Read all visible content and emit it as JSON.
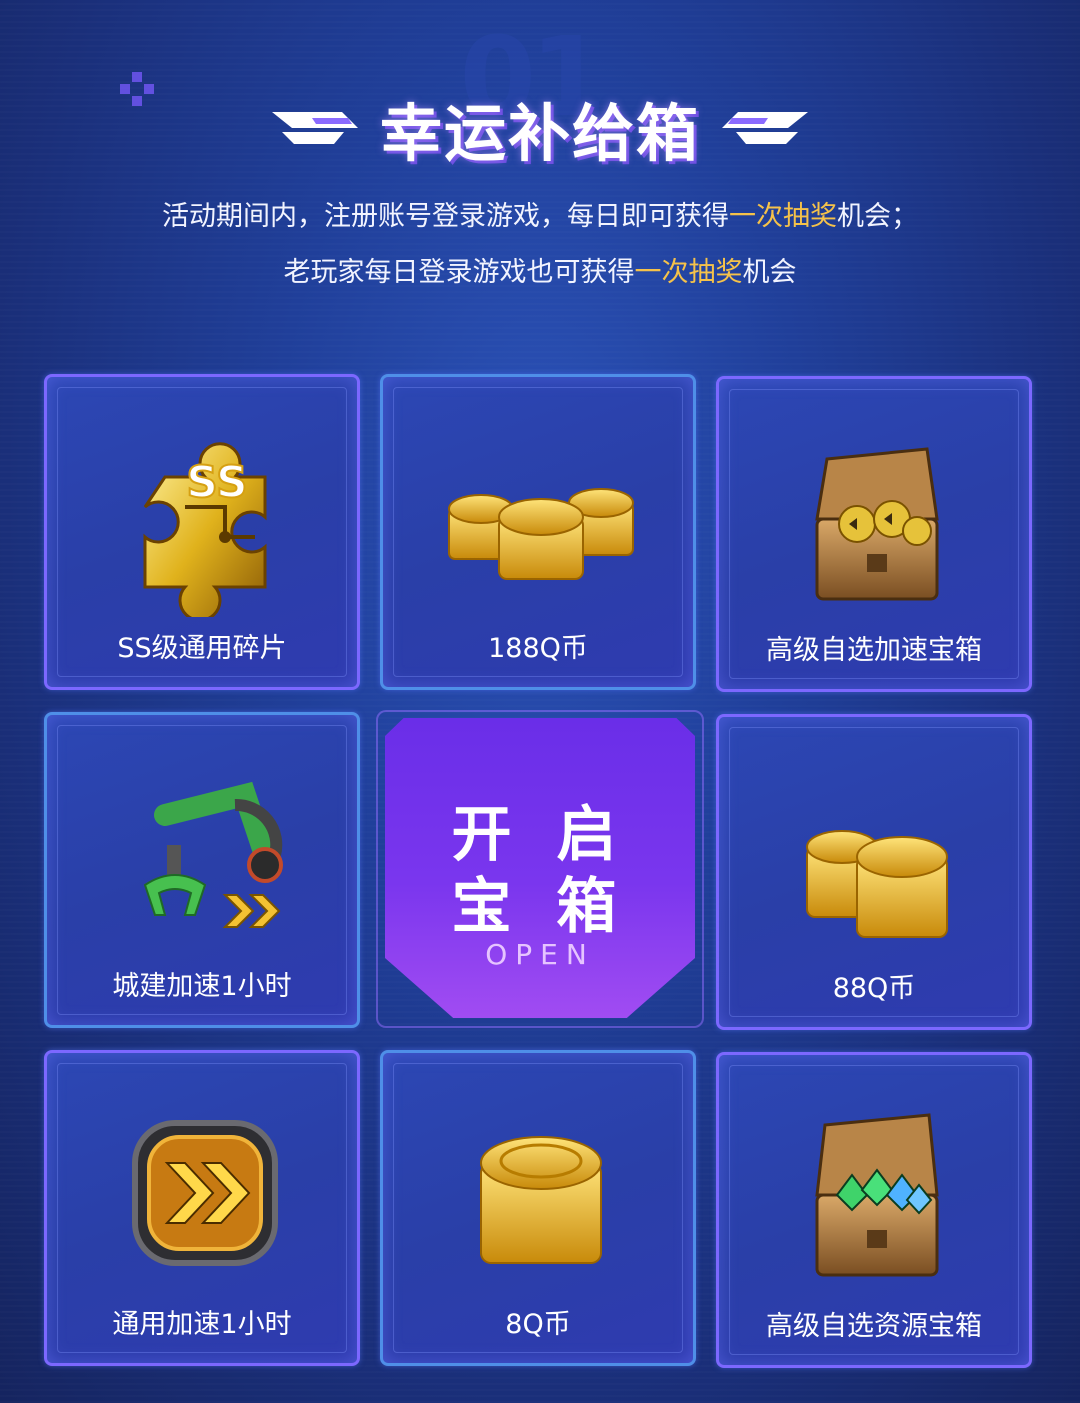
{
  "header": {
    "watermark": "01",
    "title": "幸运补给箱",
    "desc_line1": {
      "before": "活动期间内，注册账号登录游戏，每日即可获得",
      "highlight": "一次抽奖",
      "after": "机会；"
    },
    "desc_line2": {
      "before": "老玩家每日登录游戏也可获得",
      "highlight": "一次抽奖",
      "after": "机会"
    }
  },
  "rewards": [
    {
      "label": "SS级通用碎片",
      "icon": "puzzle-piece-icon"
    },
    {
      "label": "188Q币",
      "icon": "coin-pile-icon"
    },
    {
      "label": "高级自选加速宝箱",
      "icon": "speedup-chest-icon"
    },
    {
      "label": "城建加速1小时",
      "icon": "crane-claw-icon"
    },
    {
      "label": "88Q币",
      "icon": "coin-stack-icon"
    },
    {
      "label": "通用加速1小时",
      "icon": "speedup-badge-icon"
    },
    {
      "label": "8Q币",
      "icon": "coin-icon"
    },
    {
      "label": "高级自选资源宝箱",
      "icon": "resource-chest-icon"
    }
  ],
  "open_button": {
    "line1": "开 启",
    "line2": "宝 箱",
    "sub": "OPEN"
  },
  "colors": {
    "highlight": "#f5c24a",
    "card_border": "#7c68ff",
    "button": "#7a36ee"
  }
}
